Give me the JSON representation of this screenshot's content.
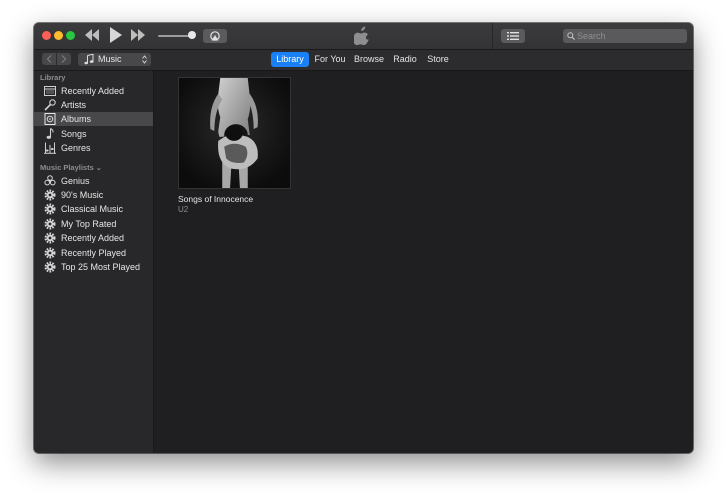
{
  "search": {
    "placeholder": "Search"
  },
  "toolbar": {
    "media_kind": "Music",
    "tabs": [
      {
        "label": "Library",
        "active": true
      },
      {
        "label": "For You",
        "active": false
      },
      {
        "label": "Browse",
        "active": false
      },
      {
        "label": "Radio",
        "active": false
      },
      {
        "label": "Store",
        "active": false
      }
    ]
  },
  "sidebar": {
    "library_title": "Library",
    "library_items": [
      {
        "label": "Recently Added",
        "icon": "recently-added-icon"
      },
      {
        "label": "Artists",
        "icon": "microphone-icon"
      },
      {
        "label": "Albums",
        "icon": "album-icon",
        "selected": true
      },
      {
        "label": "Songs",
        "icon": "music-note-icon"
      },
      {
        "label": "Genres",
        "icon": "genres-icon"
      }
    ],
    "playlists_title": "Music Playlists",
    "playlist_items": [
      {
        "label": "Genius",
        "icon": "genius-icon"
      },
      {
        "label": "90's Music",
        "icon": "smart-playlist-gear-icon"
      },
      {
        "label": "Classical Music",
        "icon": "smart-playlist-gear-icon"
      },
      {
        "label": "My Top Rated",
        "icon": "smart-playlist-gear-icon"
      },
      {
        "label": "Recently Added",
        "icon": "smart-playlist-gear-icon"
      },
      {
        "label": "Recently Played",
        "icon": "smart-playlist-gear-icon"
      },
      {
        "label": "Top 25 Most Played",
        "icon": "smart-playlist-gear-icon"
      }
    ]
  },
  "albums": [
    {
      "title": "Songs of Innocence",
      "artist": "U2"
    }
  ],
  "colors": {
    "accent": "#1a80f5",
    "window_bg": "#1f1f21",
    "sidebar_bg": "#28282a",
    "selected_row": "#48484a"
  }
}
